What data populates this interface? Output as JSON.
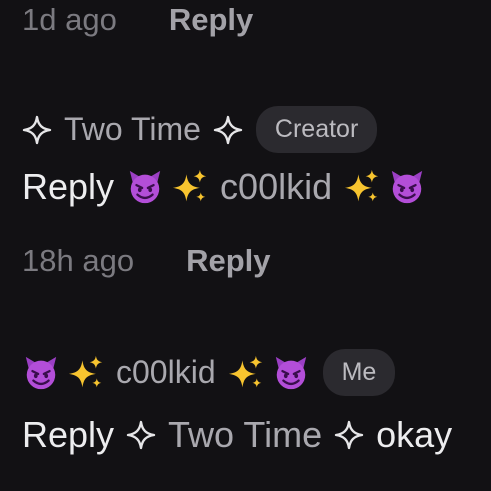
{
  "comment_top": {
    "timestamp": "1d ago",
    "reply_label": "Reply"
  },
  "comment_two_time": {
    "author": "Two Time",
    "badge": "Creator",
    "reply_prefix": "Reply",
    "mention": "c00lkid",
    "timestamp": "18h ago",
    "reply_label": "Reply"
  },
  "comment_coolkid": {
    "author": "c00lkid",
    "badge": "Me",
    "reply_prefix": "Reply",
    "mention": "Two Time",
    "body": "okay"
  },
  "colors": {
    "background": "#121114",
    "author_text": "#a9a8ae",
    "body_text": "#ededef",
    "badge_bg": "#2b2a2f"
  },
  "icons": [
    "four-point-star-icon",
    "smiling-devil-icon",
    "sparkles-icon"
  ]
}
